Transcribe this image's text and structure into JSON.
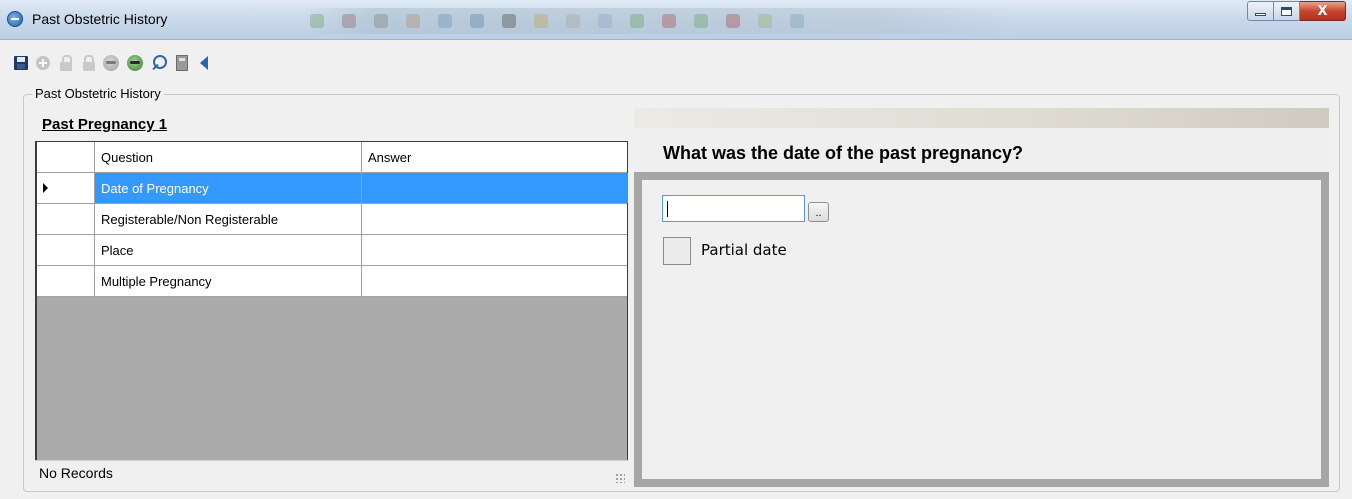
{
  "window": {
    "title": "Past Obstetric History",
    "minimize": "minimize",
    "maximize": "maximize",
    "close": "X"
  },
  "toolbar": {
    "buttons": [
      {
        "name": "save",
        "icon": "save-icon",
        "enabled": true
      },
      {
        "name": "add",
        "icon": "add-icon",
        "enabled": false
      },
      {
        "name": "unlock",
        "icon": "unlock-icon",
        "enabled": false
      },
      {
        "name": "lock",
        "icon": "lock-icon",
        "enabled": false
      },
      {
        "name": "clear",
        "icon": "clear-icon",
        "enabled": false
      },
      {
        "name": "clear-all",
        "icon": "clear-all-icon",
        "enabled": true
      },
      {
        "name": "find",
        "icon": "search-icon",
        "enabled": true
      },
      {
        "name": "calculator",
        "icon": "calculator-icon",
        "enabled": true
      },
      {
        "name": "back",
        "icon": "back-arrow-icon",
        "enabled": true
      }
    ]
  },
  "group": {
    "legend": "Past Obstetric History",
    "pregnancy_title": "Past Pregnancy 1"
  },
  "grid": {
    "columns": [
      "",
      "Question",
      "Answer"
    ],
    "rows": [
      {
        "question": "Date of Pregnancy",
        "answer": "",
        "selected": true
      },
      {
        "question": "Registerable/Non Registerable",
        "answer": "",
        "selected": false
      },
      {
        "question": "Place",
        "answer": "",
        "selected": false
      },
      {
        "question": "Multiple Pregnancy",
        "answer": "",
        "selected": false
      }
    ],
    "status": "No Records"
  },
  "question_panel": {
    "question": "What was the date of the past pregnancy?",
    "date_value": "",
    "browse_label": "..",
    "partial_date_label": "Partial date",
    "partial_date_checked": false
  },
  "colors": {
    "selection": "#3399ff",
    "grid_background": "#ababab",
    "panel_border": "#a6a6a6"
  }
}
